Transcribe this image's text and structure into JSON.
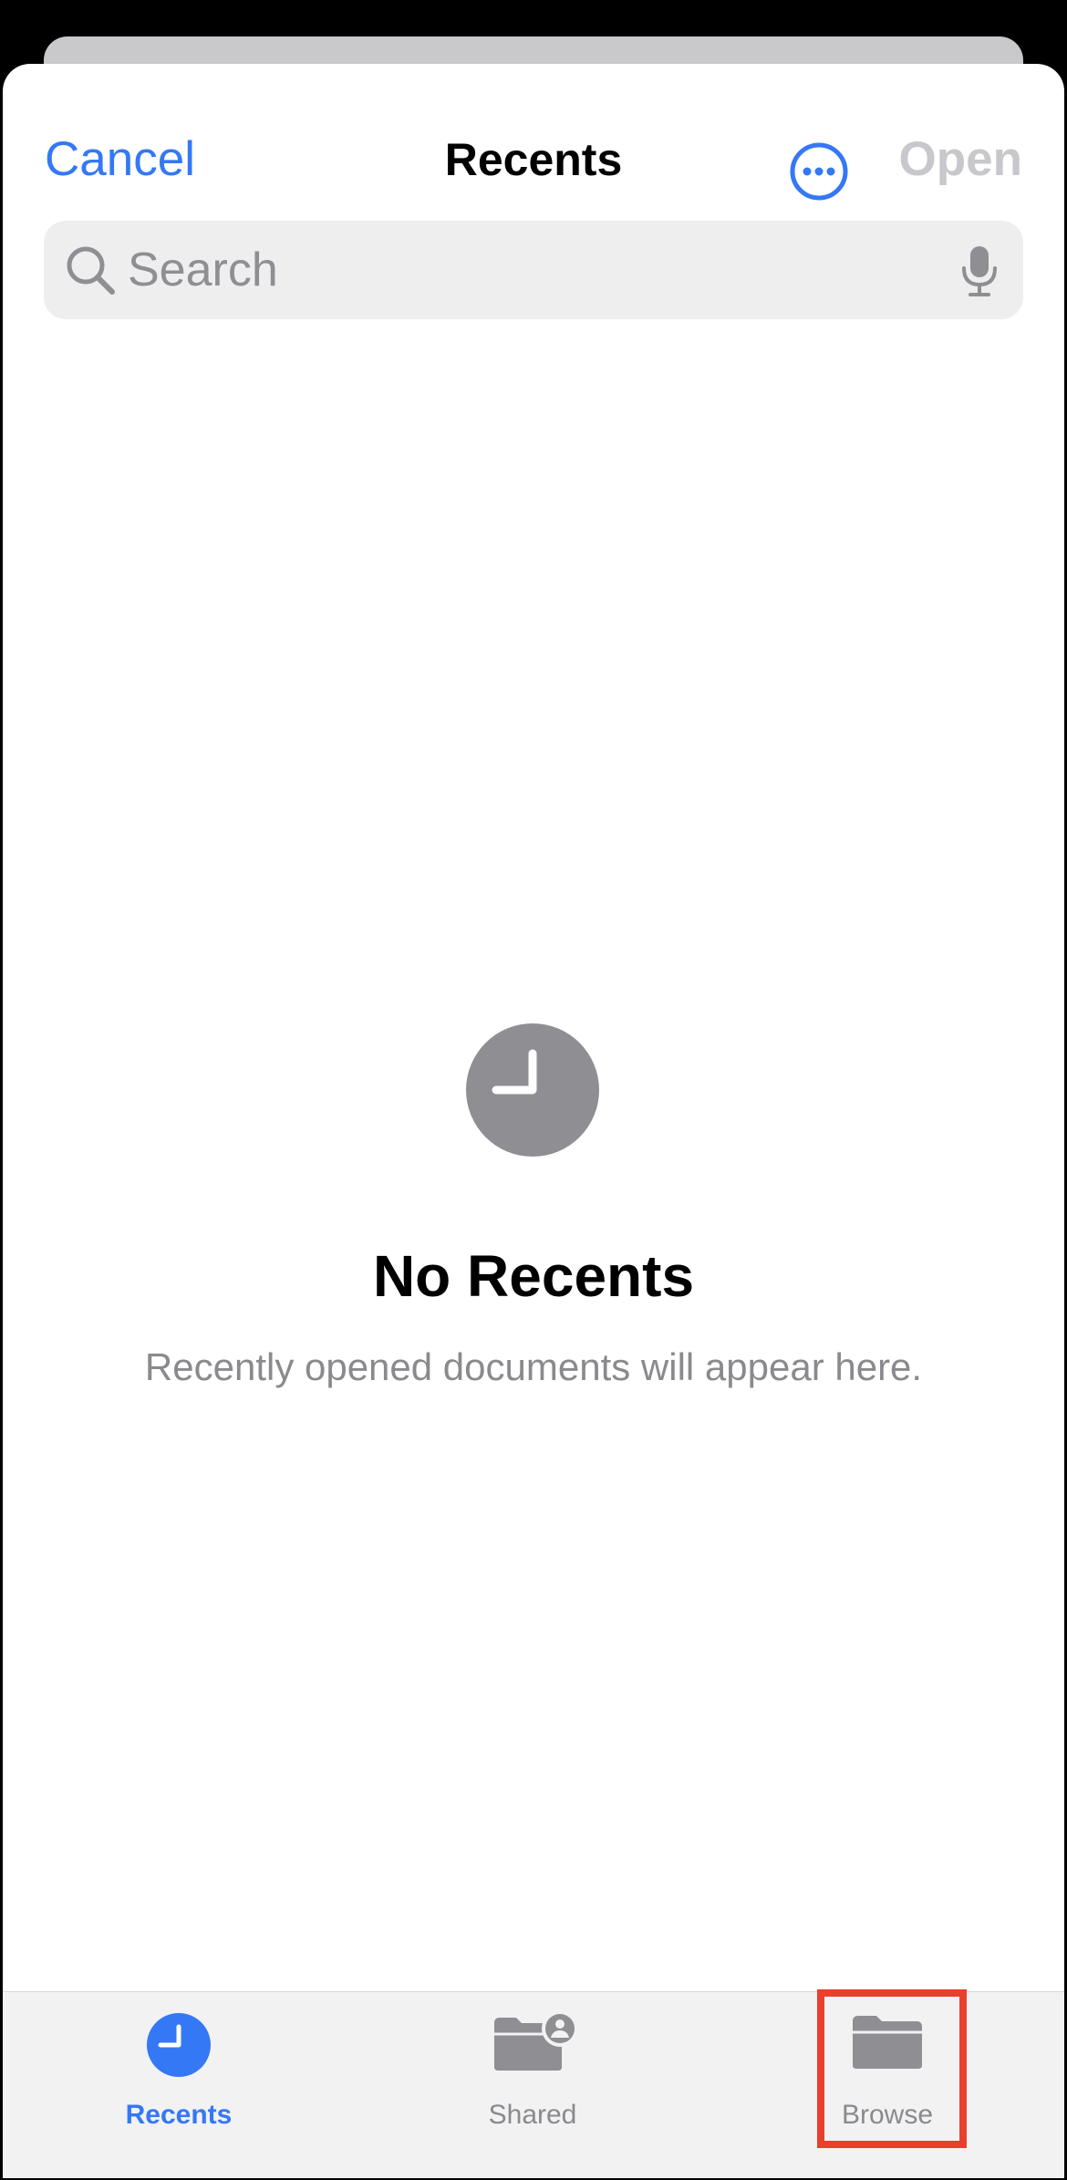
{
  "nav": {
    "cancel_label": "Cancel",
    "title": "Recents",
    "more_icon": "ellipsis-circle-icon",
    "open_label": "Open"
  },
  "search": {
    "placeholder": "Search",
    "value": "",
    "icon": "search-icon",
    "mic_icon": "microphone-icon"
  },
  "empty_state": {
    "icon": "clock-icon",
    "title": "No Recents",
    "subtitle": "Recently opened documents will appear here."
  },
  "tabbar": {
    "tabs": [
      {
        "label": "Recents",
        "icon": "clock-icon",
        "selected": true
      },
      {
        "label": "Shared",
        "icon": "shared-folder-icon",
        "selected": false
      },
      {
        "label": "Browse",
        "icon": "folder-icon",
        "selected": false
      }
    ]
  },
  "colors": {
    "accent": "#3478f6",
    "disabled": "#c7c7cc",
    "icon_gray": "#8e8e93",
    "highlight": "#e8402c"
  }
}
